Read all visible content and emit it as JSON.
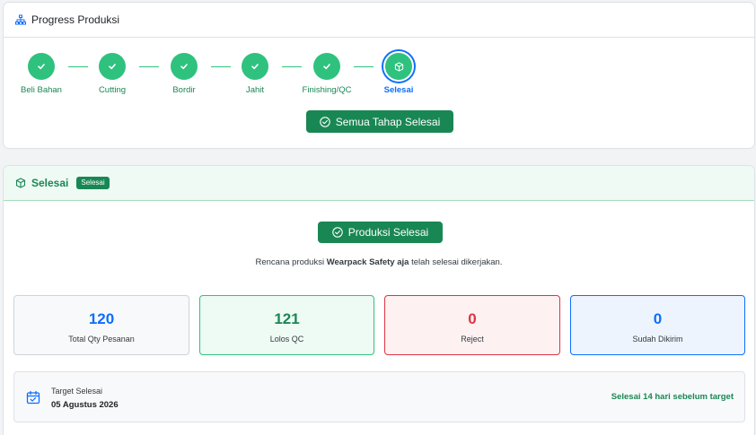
{
  "progress": {
    "title": "Progress Produksi",
    "steps": [
      {
        "label": "Beli Bahan"
      },
      {
        "label": "Cutting"
      },
      {
        "label": "Bordir"
      },
      {
        "label": "Jahit"
      },
      {
        "label": "Finishing/QC"
      },
      {
        "label": "Selesai"
      }
    ],
    "active_step": "Selesai",
    "all_done_button": "Semua Tahap Selesai"
  },
  "finished": {
    "title": "Selesai",
    "badge": "Selesai",
    "done_button": "Produksi Selesai",
    "description": {
      "prefix": "Rencana produksi",
      "product": "Wearpack Safety aja",
      "suffix": "telah selesai dikerjakan."
    },
    "stats": [
      {
        "value": "120",
        "label": "Total Qty Pesanan"
      },
      {
        "value": "121",
        "label": "Lolos QC"
      },
      {
        "value": "0",
        "label": "Reject"
      },
      {
        "value": "0",
        "label": "Sudah Dikirim"
      }
    ],
    "target": {
      "label": "Target Selesai",
      "date": "05 Agustus 2026",
      "status": "Selesai 14 hari sebelum target"
    }
  },
  "colors": {
    "success": "#198754",
    "success_light": "#2ec27e",
    "primary": "#0d6efd",
    "danger": "#dc3545"
  },
  "icons": {
    "progress_header": "sitemap-icon",
    "step_done": "check-icon",
    "step_active": "box-icon",
    "button": "check-circle-icon",
    "finished_header": "box-icon",
    "target": "calendar-icon"
  }
}
